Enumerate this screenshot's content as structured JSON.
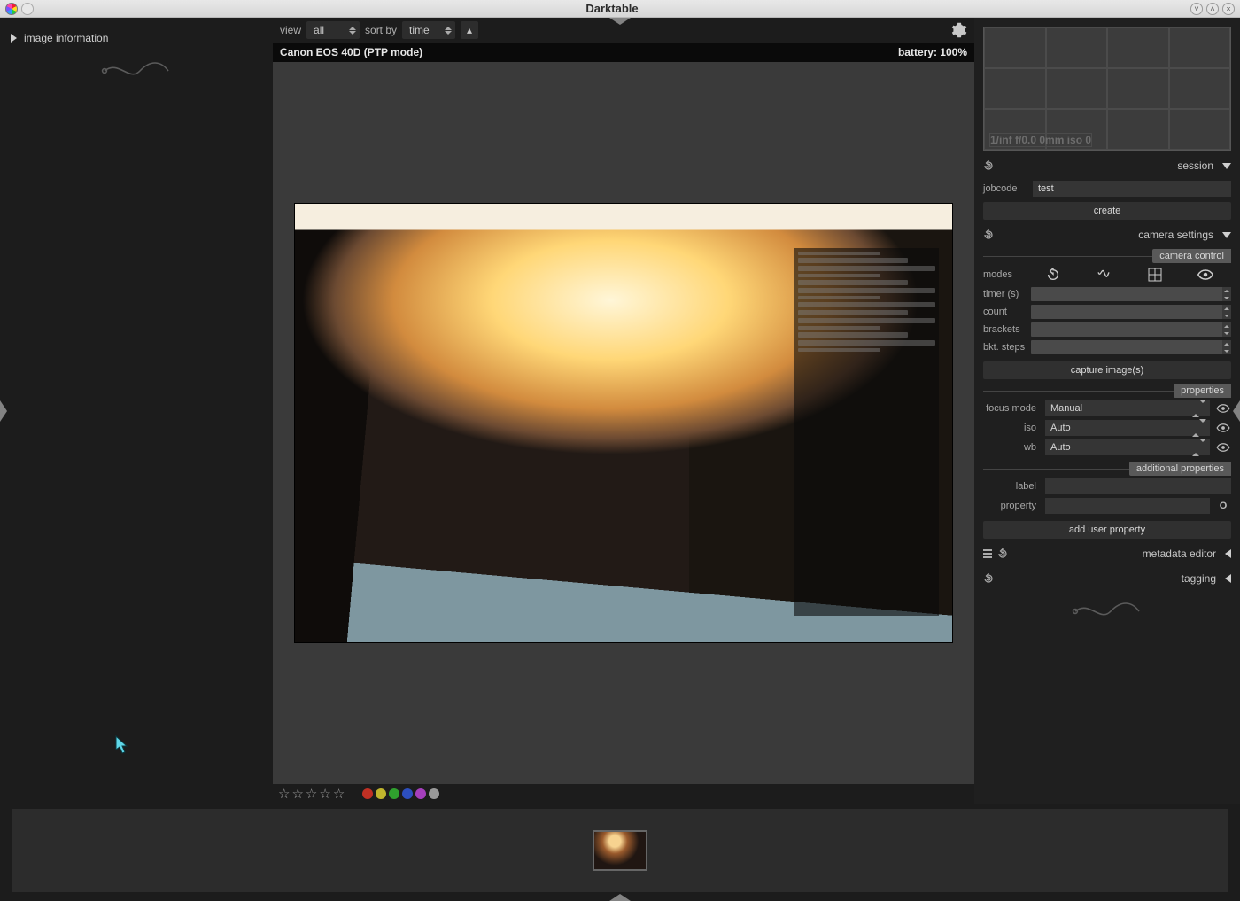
{
  "window": {
    "title": "Darktable"
  },
  "left": {
    "image_information": "image information"
  },
  "toolbar": {
    "view_label": "view",
    "view_value": "all",
    "sort_label": "sort by",
    "sort_value": "time",
    "sort_dir_glyph": "▴"
  },
  "info": {
    "camera": "Canon EOS 40D (PTP mode)",
    "battery": "battery: 100%"
  },
  "histogram_info": "1/inf f/0.0 0mm iso 0",
  "session": {
    "title": "session",
    "jobcode_label": "jobcode",
    "jobcode_value": "test",
    "create_label": "create"
  },
  "camera_settings": {
    "title": "camera settings",
    "section_control": "camera control",
    "modes_label": "modes",
    "timer_label": "timer (s)",
    "count_label": "count",
    "brackets_label": "brackets",
    "bktsteps_label": "bkt. steps",
    "capture_label": "capture image(s)",
    "section_properties": "properties",
    "focus_label": "focus mode",
    "focus_value": "Manual",
    "iso_label": "iso",
    "iso_value": "Auto",
    "wb_label": "wb",
    "wb_value": "Auto",
    "section_additional": "additional properties",
    "addl_label_label": "label",
    "addl_property_label": "property",
    "addl_o": "O",
    "add_user_prop": "add user property"
  },
  "metadata_editor": {
    "title": "metadata editor"
  },
  "tagging": {
    "title": "tagging"
  },
  "labels": {
    "red": "#c13024",
    "yellow": "#c0b52d",
    "green": "#2fa12e",
    "blue": "#2d4fbf",
    "purple": "#a63fbd",
    "grey": "#9a9a9a"
  }
}
